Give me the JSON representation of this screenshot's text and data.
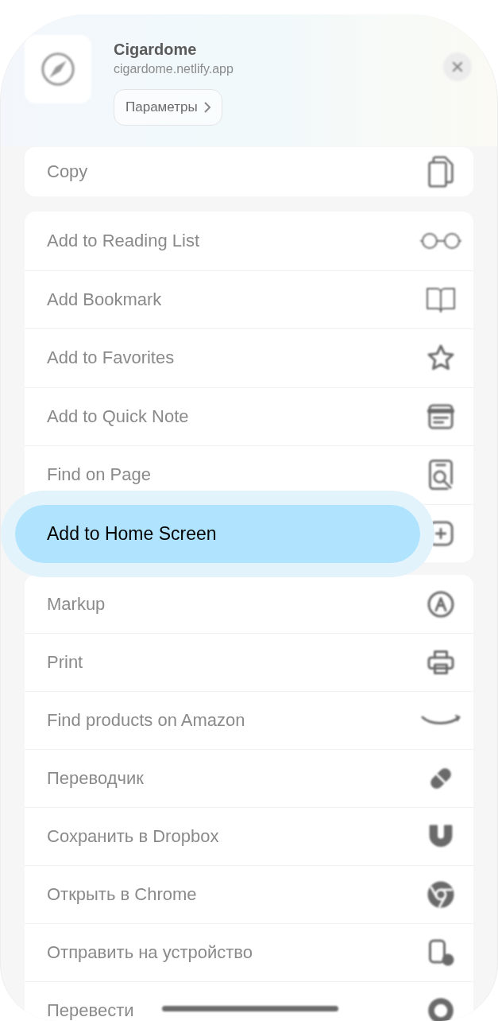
{
  "header": {
    "title": "Cigardome",
    "subtitle": "cigardome.netlify.app",
    "options_button": "Параметры"
  },
  "sections": [
    {
      "items": [
        {
          "label": "Copy",
          "selected": false
        }
      ]
    },
    {
      "items": [
        {
          "label": "Add to Reading List",
          "selected": false
        },
        {
          "label": "Add Bookmark",
          "selected": false
        },
        {
          "label": "Add to Favorites",
          "selected": false
        },
        {
          "label": "Add to Quick Note",
          "selected": false
        },
        {
          "label": "Find on Page",
          "selected": false
        },
        {
          "label": "Add to Home Screen",
          "selected": true
        }
      ]
    },
    {
      "items": [
        {
          "label": "Markup",
          "selected": false
        },
        {
          "label": "Print",
          "selected": false
        },
        {
          "label": "Find products on Amazon",
          "selected": false
        },
        {
          "label": "Переводчик",
          "selected": false
        },
        {
          "label": "Сохранить в Dropbox",
          "selected": false
        },
        {
          "label": "Открыть в Chrome",
          "selected": false
        },
        {
          "label": "Отправить на устройство",
          "selected": false
        },
        {
          "label": "Перевести",
          "selected": false
        }
      ]
    }
  ]
}
